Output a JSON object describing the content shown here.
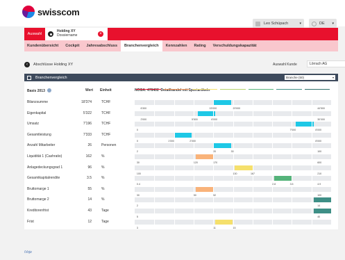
{
  "brand": {
    "name": "swisscom"
  },
  "header": {
    "user_name": "Leo Schüpach",
    "language": "DE",
    "chevron": "▾"
  },
  "tabs": {
    "auswahl": "Auswahl",
    "holding_title": "Holding XY",
    "holding_sub": "Dossiername",
    "close": "×"
  },
  "nav": [
    {
      "label": "Kundenübersicht"
    },
    {
      "label": "Cockpit"
    },
    {
      "label": "Jahresabschluss"
    },
    {
      "label": "Branchenvergleich",
      "active": true
    },
    {
      "label": "Kennzahlen"
    },
    {
      "label": "Rating"
    },
    {
      "label": "Verschuldungskapazität"
    }
  ],
  "selection": {
    "back_label": "Abschlüsse Holding XY",
    "kunde_label": "Auswahl Kunde",
    "kunde_value": "Lörrach AG"
  },
  "panel": {
    "title": "Branchenvergleich",
    "branche_value": "Branche (50)",
    "col_basis": "Basis 2013",
    "col_wert": "Wert",
    "col_einheit": "Einheit",
    "noga_code": "NOGA: 476402",
    "noga_text": "Detailhandel mit Sportartikeln"
  },
  "colors": {
    "brand_red": "#e8112d",
    "nav_pink": "#f9c7cd",
    "panel_head": "#3d4a5c",
    "cyan": "#1ec8e6",
    "orange": "#f9b37a",
    "yellow": "#f5e06c",
    "green": "#55b37a",
    "teal": "#3e8f86",
    "track": "#e8eaed"
  },
  "strip_colors": [
    "#e8112d",
    "#f08a4b",
    "#f5e06c",
    "#b6d36a",
    "#55b37a",
    "#3e8f86",
    "#2e6e6a"
  ],
  "rows": [
    {
      "label": "Bilanzsumme",
      "value": "18'374",
      "unit": "TCHF",
      "bar_color": "cyan",
      "bar_from": 0.4,
      "bar_to": 0.49,
      "ticks": [
        {
          "t": "6'300",
          "p": 0.03
        },
        {
          "t": "15'000",
          "p": 0.38
        },
        {
          "t": "20'000",
          "p": 0.5
        },
        {
          "t": "44'500",
          "p": 0.93
        }
      ]
    },
    {
      "label": "Eigenkapital",
      "value": "5'322",
      "unit": "TCHF",
      "bar_color": "cyan",
      "bar_from": 0.32,
      "bar_to": 0.41,
      "ticks": [
        {
          "t": "2'000",
          "p": 0.03
        },
        {
          "t": "5'500",
          "p": 0.29
        },
        {
          "t": "6'000",
          "p": 0.39
        },
        {
          "t": "30'000",
          "p": 0.93
        }
      ]
    },
    {
      "label": "Umsatz",
      "value": "7'196",
      "unit": "TCHF",
      "bar_color": "cyan",
      "bar_from": 0.82,
      "bar_to": 0.91,
      "ticks": [
        {
          "t": "0",
          "p": 0.01
        },
        {
          "t": "7'000",
          "p": 0.79
        },
        {
          "t": "8'000",
          "p": 0.92
        }
      ]
    },
    {
      "label": "Gesamtleistung",
      "value": "7'333",
      "unit": "TCHF",
      "bar_color": "cyan",
      "bar_from": 0.2,
      "bar_to": 0.29,
      "ticks": [
        {
          "t": "0",
          "p": 0.01
        },
        {
          "t": "1'000",
          "p": 0.17
        },
        {
          "t": "2'000",
          "p": 0.28
        },
        {
          "t": "8'000",
          "p": 0.92
        }
      ]
    },
    {
      "label": "Anzahl Mitarbeiter",
      "value": "26",
      "unit": "Personen",
      "bar_color": "cyan",
      "bar_from": 0.4,
      "bar_to": 0.49,
      "ticks": [
        {
          "t": "2",
          "p": 0.01
        },
        {
          "t": "20",
          "p": 0.4
        },
        {
          "t": "30",
          "p": 0.49
        },
        {
          "t": "100",
          "p": 0.93
        }
      ]
    },
    {
      "label": "Liquidität 1 (Cashratio)",
      "value": "162",
      "unit": "%",
      "bar_color": "orange",
      "bar_from": 0.31,
      "bar_to": 0.4,
      "ticks": [
        {
          "t": "30",
          "p": 0.01
        },
        {
          "t": "120",
          "p": 0.3
        },
        {
          "t": "170",
          "p": 0.4
        },
        {
          "t": "600",
          "p": 0.93
        }
      ]
    },
    {
      "label": "Anlagedeckungsgrad 1",
      "value": "96",
      "unit": "%",
      "bar_color": "yellow",
      "bar_from": 0.51,
      "bar_to": 0.6,
      "ticks": [
        {
          "t": "100",
          "p": 0.01
        },
        {
          "t": "130",
          "p": 0.5
        },
        {
          "t": "167",
          "p": 0.59
        },
        {
          "t": "210",
          "p": 0.93
        }
      ]
    },
    {
      "label": "Gesamtkapitalrendite",
      "value": "3.5",
      "unit": "%",
      "bar_color": "green",
      "bar_from": 0.71,
      "bar_to": 0.8,
      "ticks": [
        {
          "t": "0.4",
          "p": 0.01
        },
        {
          "t": "2.8",
          "p": 0.7
        },
        {
          "t": "3.5",
          "p": 0.79
        },
        {
          "t": "4.9",
          "p": 0.93
        }
      ]
    },
    {
      "label": "Bruttomarge 1",
      "value": "55",
      "unit": "%",
      "bar_color": "orange",
      "bar_from": 0.31,
      "bar_to": 0.4,
      "ticks": [
        {
          "t": "30",
          "p": 0.01
        },
        {
          "t": "50",
          "p": 0.3
        },
        {
          "t": "52",
          "p": 0.4
        },
        {
          "t": "100",
          "p": 0.93
        }
      ]
    },
    {
      "label": "Bruttomarge 2",
      "value": "14",
      "unit": "%",
      "bar_color": "teal",
      "bar_from": 0.91,
      "bar_to": 1.0,
      "ticks": [
        {
          "t": "2",
          "p": 0.01
        },
        {
          "t": "14",
          "p": 0.93
        }
      ]
    },
    {
      "label": "Kreditorenfrist",
      "value": "43",
      "unit": "Tage",
      "bar_color": "teal",
      "bar_from": 0.91,
      "bar_to": 1.0,
      "ticks": [
        {
          "t": "5",
          "p": 0.01
        },
        {
          "t": "40",
          "p": 0.93
        }
      ]
    },
    {
      "label": "Frist",
      "value": "12",
      "unit": "Tage",
      "bar_color": "yellow",
      "bar_from": 0.41,
      "bar_to": 0.5,
      "ticks": [
        {
          "t": "3",
          "p": 0.01
        },
        {
          "t": "11",
          "p": 0.4
        },
        {
          "t": "15",
          "p": 0.5
        }
      ]
    }
  ],
  "footer": {
    "logo": "iVoje"
  }
}
